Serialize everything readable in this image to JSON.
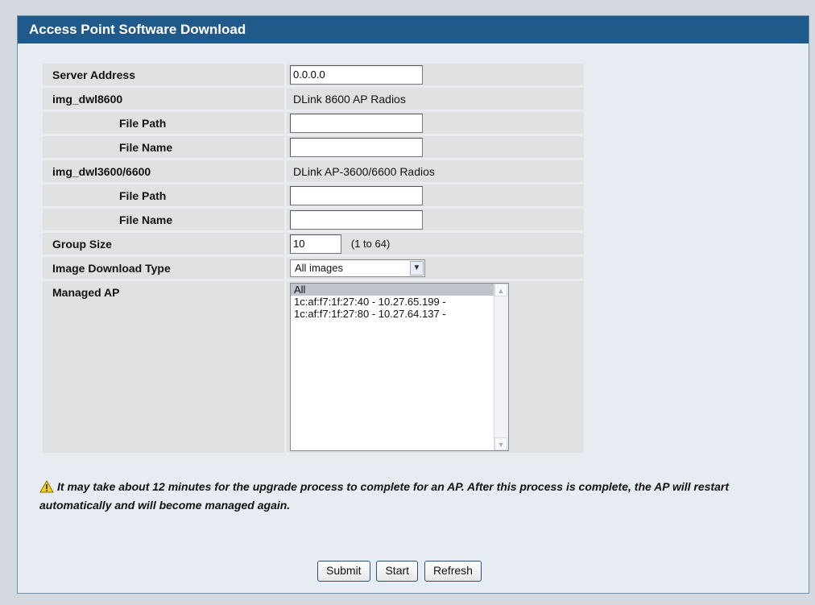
{
  "title": "Access Point Software Download",
  "fields": {
    "server_address": {
      "label": "Server Address",
      "value": "0.0.0.0"
    },
    "img1": {
      "label": "img_dwl8600",
      "desc": "DLink 8600 AP Radios"
    },
    "img1_path": {
      "label": "File Path",
      "value": ""
    },
    "img1_name": {
      "label": "File Name",
      "value": ""
    },
    "img2": {
      "label": "img_dwl3600/6600",
      "desc": "DLink AP-3600/6600 Radios"
    },
    "img2_path": {
      "label": "File Path",
      "value": ""
    },
    "img2_name": {
      "label": "File Name",
      "value": ""
    },
    "group_size": {
      "label": "Group Size",
      "value": "10",
      "range": "(1 to 64)"
    },
    "image_type": {
      "label": "Image Download Type",
      "selected": "All images"
    },
    "managed_ap": {
      "label": "Managed AP",
      "options": [
        "All",
        "1c:af:f7:1f:27:40 - 10.27.65.199 -",
        "1c:af:f7:1f:27:80 - 10.27.64.137 -"
      ]
    }
  },
  "note": "It may take about 12 minutes for the upgrade process to complete for an AP. After this process is complete, the AP will restart automatically and will become managed again.",
  "buttons": {
    "submit": "Submit",
    "start": "Start",
    "refresh": "Refresh"
  },
  "colors": {
    "titlebar": "#205a8a",
    "panel": "#e7ecf2",
    "cell": "#e1e1e1"
  }
}
